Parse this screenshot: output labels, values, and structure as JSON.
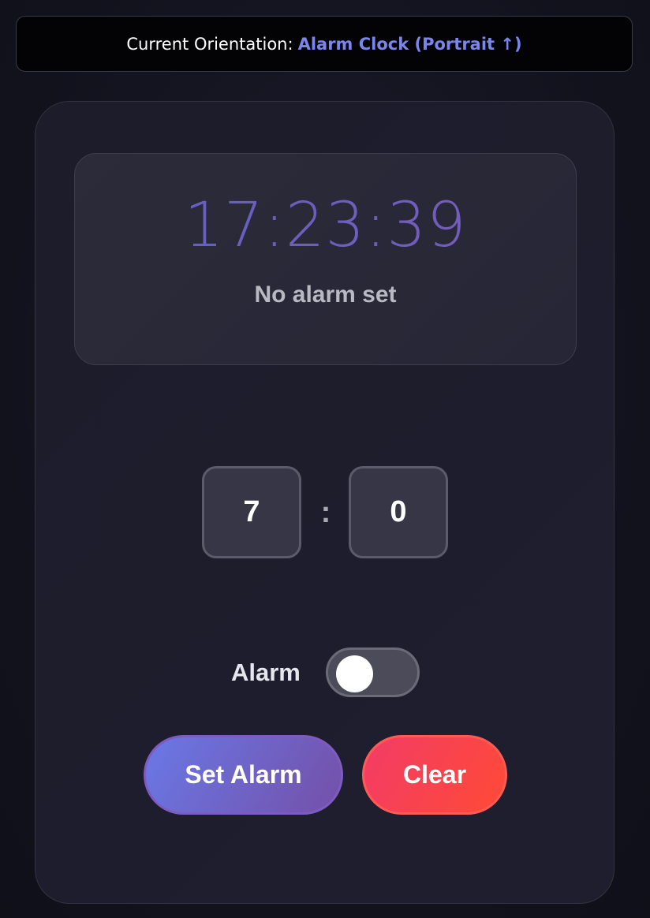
{
  "orientation": {
    "prefix": "Current Orientation:",
    "value": "Alarm Clock (Portrait ↑)",
    "value_color": "#7b86ec"
  },
  "clock": {
    "time": "17:23:39",
    "status": "No alarm set"
  },
  "alarm_time": {
    "hour": "7",
    "separator": ":",
    "minute": "0"
  },
  "alarm_toggle": {
    "label": "Alarm",
    "enabled": false
  },
  "buttons": {
    "set_label": "Set Alarm",
    "clear_label": "Clear"
  },
  "colors": {
    "background": "#13131f",
    "accent_purple": "#7b86ec",
    "set_gradient_start": "#6a78e6",
    "set_gradient_end": "#7450a8",
    "clear_gradient_start": "#f23c67",
    "clear_gradient_end": "#ff4a36"
  }
}
